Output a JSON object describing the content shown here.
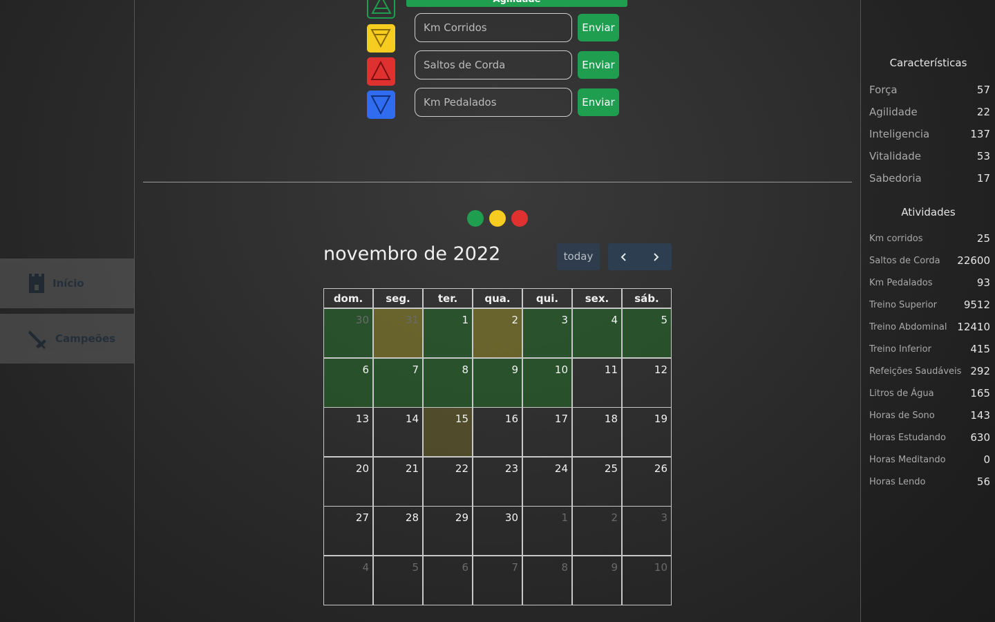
{
  "sidebar": {
    "items": [
      {
        "label": "Início",
        "icon": "castle-icon"
      },
      {
        "label": "Campeões",
        "icon": "sword-icon"
      }
    ]
  },
  "attributes": {
    "badge": "Agilidade",
    "inputs": [
      {
        "placeholder": "Km Corridos",
        "button": "Enviar"
      },
      {
        "placeholder": "Saltos de Corda",
        "button": "Enviar"
      },
      {
        "placeholder": "Km Pedalados",
        "button": "Enviar"
      }
    ],
    "triangle_buttons": [
      {
        "color": "#1e9e4e",
        "icon": "triangle-up-icon"
      },
      {
        "color": "#f5cc1f",
        "icon": "triangle-down-bar-icon"
      },
      {
        "color": "#e03131",
        "icon": "triangle-up-icon"
      },
      {
        "color": "#2f6cf0",
        "icon": "triangle-down-icon"
      }
    ]
  },
  "status_dots": [
    "#1e9e4e",
    "#f5cc1f",
    "#e03131"
  ],
  "calendar": {
    "title": "novembro de 2022",
    "today_label": "today",
    "weekdays": [
      "dom.",
      "seg.",
      "ter.",
      "qua.",
      "qui.",
      "sex.",
      "sáb."
    ],
    "weeks": [
      [
        {
          "d": "30",
          "o": true,
          "c": "green"
        },
        {
          "d": "31",
          "o": true,
          "c": "yellow"
        },
        {
          "d": "1",
          "c": "green"
        },
        {
          "d": "2",
          "c": "yellow"
        },
        {
          "d": "3",
          "c": "green"
        },
        {
          "d": "4",
          "c": "green"
        },
        {
          "d": "5",
          "c": "green"
        }
      ],
      [
        {
          "d": "6",
          "c": "green"
        },
        {
          "d": "7",
          "c": "green"
        },
        {
          "d": "8",
          "c": "green"
        },
        {
          "d": "9",
          "c": "green"
        },
        {
          "d": "10",
          "c": "green"
        },
        {
          "d": "11"
        },
        {
          "d": "12"
        }
      ],
      [
        {
          "d": "13"
        },
        {
          "d": "14"
        },
        {
          "d": "15",
          "c": "yellow dim"
        },
        {
          "d": "16"
        },
        {
          "d": "17"
        },
        {
          "d": "18"
        },
        {
          "d": "19"
        }
      ],
      [
        {
          "d": "20"
        },
        {
          "d": "21"
        },
        {
          "d": "22"
        },
        {
          "d": "23"
        },
        {
          "d": "24"
        },
        {
          "d": "25"
        },
        {
          "d": "26"
        }
      ],
      [
        {
          "d": "27"
        },
        {
          "d": "28"
        },
        {
          "d": "29"
        },
        {
          "d": "30"
        },
        {
          "d": "1",
          "o": true
        },
        {
          "d": "2",
          "o": true
        },
        {
          "d": "3",
          "o": true
        }
      ],
      [
        {
          "d": "4",
          "o": true
        },
        {
          "d": "5",
          "o": true
        },
        {
          "d": "6",
          "o": true
        },
        {
          "d": "7",
          "o": true
        },
        {
          "d": "8",
          "o": true
        },
        {
          "d": "9",
          "o": true
        },
        {
          "d": "10",
          "o": true
        }
      ]
    ]
  },
  "stats": {
    "characteristics_title": "Características",
    "characteristics": [
      {
        "name": "Força",
        "value": "57"
      },
      {
        "name": "Agilidade",
        "value": "22"
      },
      {
        "name": "Inteligencia",
        "value": "137"
      },
      {
        "name": "Vitalidade",
        "value": "53"
      },
      {
        "name": "Sabedoria",
        "value": "17"
      }
    ],
    "activities_title": "Atividades",
    "activities": [
      {
        "name": "Km corridos",
        "value": "25"
      },
      {
        "name": "Saltos de Corda",
        "value": "22600"
      },
      {
        "name": "Km Pedalados",
        "value": "93"
      },
      {
        "name": "Treino Superior",
        "value": "9512"
      },
      {
        "name": "Treino Abdominal",
        "value": "12410"
      },
      {
        "name": "Treino Inferior",
        "value": "415"
      },
      {
        "name": "Refeições Saudáveis",
        "value": "292"
      },
      {
        "name": "Litros de Água",
        "value": "165"
      },
      {
        "name": "Horas de Sono",
        "value": "143"
      },
      {
        "name": "Horas Estudando",
        "value": "630"
      },
      {
        "name": "Horas Meditando",
        "value": "0"
      },
      {
        "name": "Horas Lendo",
        "value": "56"
      }
    ]
  }
}
